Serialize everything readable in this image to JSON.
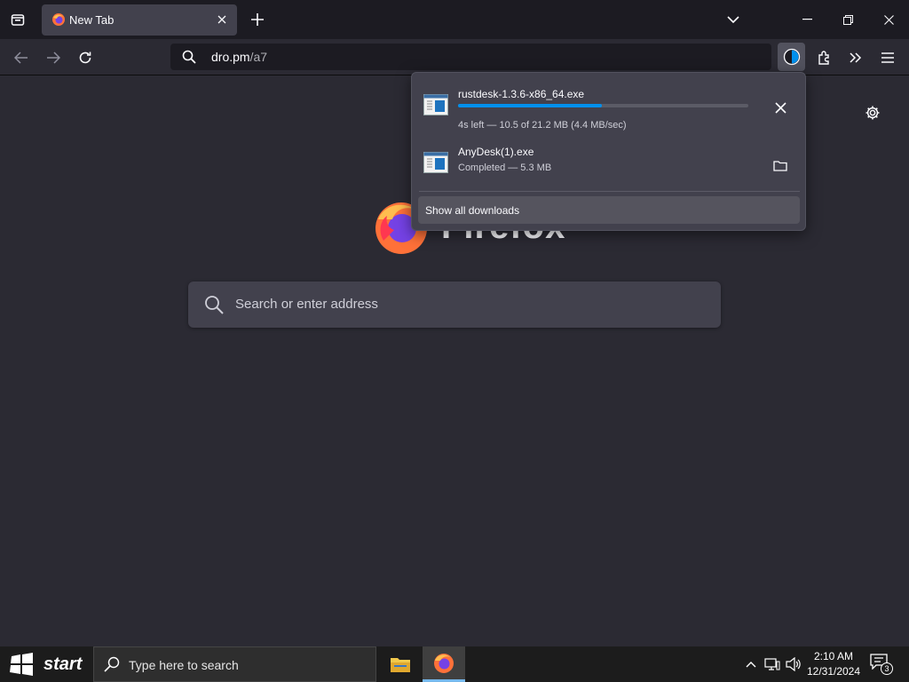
{
  "browser": {
    "tab": {
      "title": "New Tab"
    },
    "urlbar": {
      "host": "dro.pm",
      "path": "/a7"
    }
  },
  "newtab": {
    "brand": "Firefox",
    "search_placeholder": "Search or enter address"
  },
  "downloads": {
    "items": [
      {
        "name": "rustdesk-1.3.6-x86_64.exe",
        "status": "4s left — 10.5 of 21.2 MB (4.4 MB/sec)",
        "progress": 0.495
      },
      {
        "name": "AnyDesk(1).exe",
        "status": "Completed — 5.3 MB"
      }
    ],
    "show_all_label": "Show all downloads"
  },
  "taskbar": {
    "start_label": "start",
    "search_placeholder": "Type here to search",
    "time": "2:10 AM",
    "date": "12/31/2024",
    "notification_count": "3"
  },
  "colors": {
    "accent": "#0090ed",
    "panel": "#42414d",
    "background": "#2b2a33"
  }
}
